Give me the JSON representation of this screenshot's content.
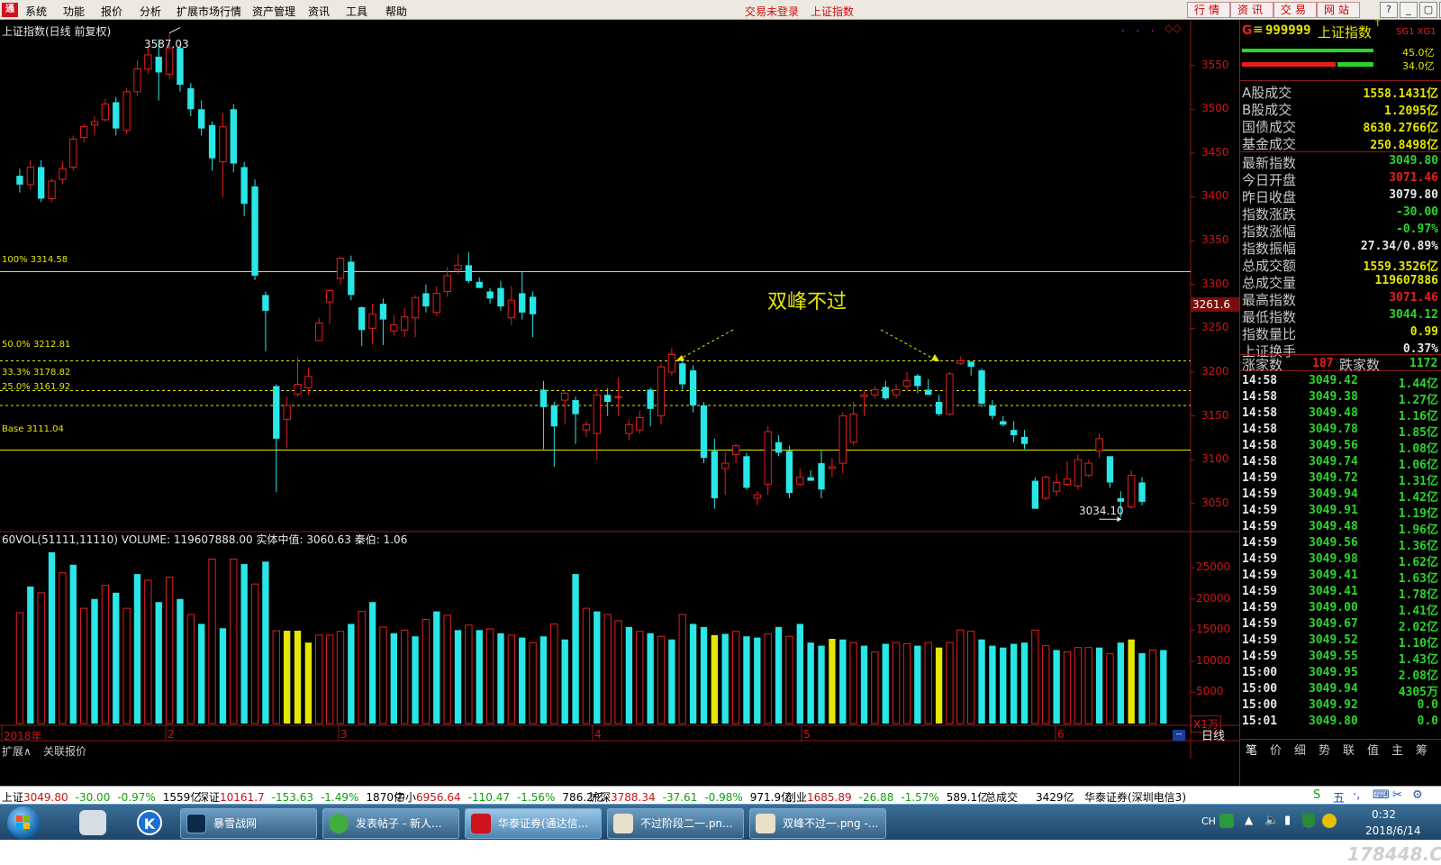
{
  "menu": {
    "logo": "通",
    "items": [
      "系统",
      "功能",
      "报价",
      "分析",
      "扩展市场行情",
      "资产管理",
      "资讯",
      "工具",
      "帮助"
    ],
    "status1": "交易未登录",
    "status2": "上证指数",
    "right_buttons": [
      "行情",
      "资讯",
      "交易",
      "网站"
    ],
    "window_buttons": [
      "?",
      "_",
      "▢",
      "✕"
    ]
  },
  "chart": {
    "title": "上证指数(日线 前复权)",
    "high_label": "3587.03",
    "low_label": "3034.10",
    "annotation": "双峰不过",
    "cursor_price": "3261.6",
    "fib": [
      {
        "label": "100% 3314.58",
        "value": 3314.58,
        "color": "#e6e600"
      },
      {
        "label": "50.0% 3212.81",
        "value": 3212.81,
        "color": "#e6e600"
      },
      {
        "label": "33.3% 3178.82",
        "value": 3178.82,
        "color": "#e6e600"
      },
      {
        "label": "25.0% 3161.92",
        "value": 3161.92,
        "color": "#e6e600"
      },
      {
        "label": "Base 3111.04",
        "value": 3111.04,
        "color": "#e6e600"
      }
    ],
    "price_axis": [
      "3550",
      "3500",
      "3450",
      "3400",
      "3350",
      "3300",
      "3250",
      "3200",
      "3150",
      "3100",
      "3050"
    ],
    "vol_title": "60VOL(51111,11110) VOLUME: 119607888.00 实体中值: 3060.63 秦伯: 1.06",
    "vol_axis": [
      "25000",
      "20000",
      "15000",
      "10000",
      "5000"
    ],
    "vol_unit": "X1万",
    "date_labels": [
      "2018年",
      "2",
      "3",
      "4",
      "5",
      "6"
    ],
    "bottom_tabs": [
      "扩展∧",
      "关联报价"
    ],
    "period": "日线"
  },
  "chart_data": {
    "type": "candlestick",
    "ylim": [
      3020,
      3600
    ],
    "candles": [
      [
        3424,
        3414,
        3432,
        3405
      ],
      [
        3414,
        3434,
        3442,
        3408
      ],
      [
        3434,
        3398,
        3442,
        3394
      ],
      [
        3398,
        3418,
        3421,
        3394
      ],
      [
        3420,
        3432,
        3440,
        3415
      ],
      [
        3434,
        3466,
        3470,
        3430
      ],
      [
        3468,
        3480,
        3484,
        3462
      ],
      [
        3482,
        3486,
        3492,
        3470
      ],
      [
        3488,
        3506,
        3512,
        3486
      ],
      [
        3508,
        3478,
        3514,
        3470
      ],
      [
        3476,
        3520,
        3524,
        3472
      ],
      [
        3520,
        3546,
        3556,
        3516
      ],
      [
        3546,
        3562,
        3572,
        3540
      ],
      [
        3560,
        3542,
        3580,
        3510
      ],
      [
        3540,
        3570,
        3587.03,
        3535
      ],
      [
        3570,
        3528,
        3574,
        3520
      ],
      [
        3524,
        3500,
        3530,
        3492
      ],
      [
        3500,
        3478,
        3510,
        3470
      ],
      [
        3482,
        3444,
        3486,
        3430
      ],
      [
        3440,
        3480,
        3496,
        3400
      ],
      [
        3500,
        3438,
        3506,
        3428
      ],
      [
        3434,
        3392,
        3440,
        3378
      ],
      [
        3412,
        3310,
        3420,
        3305
      ],
      [
        3288,
        3270,
        3292,
        3224
      ],
      [
        3184,
        3124,
        3186,
        3063
      ],
      [
        3146,
        3162,
        3172,
        3113
      ],
      [
        3175,
        3186,
        3217,
        3172
      ],
      [
        3182,
        3195,
        3205,
        3174
      ],
      [
        3236,
        3256,
        3262,
        3236
      ],
      [
        3280,
        3293,
        3294,
        3255
      ],
      [
        3307,
        3330,
        3332,
        3300
      ],
      [
        3326,
        3288,
        3333,
        3282
      ],
      [
        3274,
        3248,
        3275,
        3230
      ],
      [
        3250,
        3266,
        3278,
        3232
      ],
      [
        3278,
        3260,
        3284,
        3231
      ],
      [
        3247,
        3254,
        3265,
        3242
      ],
      [
        3248,
        3263,
        3273,
        3240
      ],
      [
        3262,
        3285,
        3288,
        3240
      ],
      [
        3290,
        3275,
        3300,
        3268
      ],
      [
        3268,
        3290,
        3298,
        3264
      ],
      [
        3292,
        3310,
        3320,
        3286
      ],
      [
        3317,
        3322,
        3335,
        3312
      ],
      [
        3322,
        3304,
        3337,
        3302
      ],
      [
        3303,
        3296,
        3308,
        3296
      ],
      [
        3292,
        3284,
        3296,
        3278
      ],
      [
        3296,
        3275,
        3304,
        3270
      ],
      [
        3262,
        3282,
        3298,
        3254
      ],
      [
        3290,
        3268,
        3315,
        3260
      ],
      [
        3286,
        3266,
        3292,
        3240
      ],
      [
        3180,
        3160,
        3190,
        3112
      ],
      [
        3162,
        3138,
        3166,
        3092
      ],
      [
        3168,
        3176,
        3178,
        3140
      ],
      [
        3168,
        3152,
        3172,
        3118
      ],
      [
        3134,
        3140,
        3144,
        3126
      ],
      [
        3130,
        3174,
        3182,
        3100
      ],
      [
        3174,
        3166,
        3182,
        3150
      ],
      [
        3172,
        3172,
        3194,
        3150
      ],
      [
        3130,
        3140,
        3146,
        3122
      ],
      [
        3134,
        3148,
        3156,
        3130
      ],
      [
        3180,
        3158,
        3182,
        3138
      ],
      [
        3150,
        3206,
        3210,
        3140
      ],
      [
        3200,
        3220,
        3228,
        3196
      ],
      [
        3210,
        3186,
        3214,
        3180
      ],
      [
        3202,
        3162,
        3208,
        3154
      ],
      [
        3162,
        3102,
        3166,
        3096
      ],
      [
        3110,
        3056,
        3124,
        3044
      ],
      [
        3090,
        3096,
        3108,
        3060
      ],
      [
        3106,
        3116,
        3118,
        3096
      ],
      [
        3104,
        3068,
        3108,
        3066
      ],
      [
        3056,
        3060,
        3064,
        3048
      ],
      [
        3072,
        3132,
        3138,
        3060
      ],
      [
        3120,
        3108,
        3128,
        3104
      ],
      [
        3110,
        3062,
        3116,
        3056
      ],
      [
        3072,
        3080,
        3090,
        3070
      ],
      [
        3080,
        3076,
        3088,
        3076
      ],
      [
        3096,
        3066,
        3110,
        3056
      ],
      [
        3090,
        3092,
        3102,
        3080
      ],
      [
        3096,
        3150,
        3154,
        3084
      ],
      [
        3120,
        3152,
        3166,
        3116
      ],
      [
        3172,
        3174,
        3178,
        3150
      ],
      [
        3174,
        3180,
        3184,
        3170
      ],
      [
        3183,
        3170,
        3190,
        3168
      ],
      [
        3174,
        3180,
        3186,
        3170
      ],
      [
        3184,
        3190,
        3200,
        3180
      ],
      [
        3196,
        3184,
        3198,
        3176
      ],
      [
        3180,
        3174,
        3192,
        3174
      ],
      [
        3166,
        3152,
        3174,
        3150
      ],
      [
        3152,
        3198,
        3200,
        3150
      ],
      [
        3210,
        3212.81,
        3218,
        3208
      ],
      [
        3212,
        3206,
        3212,
        3196
      ],
      [
        3202,
        3164,
        3204,
        3160
      ],
      [
        3162,
        3150,
        3168,
        3146
      ],
      [
        3144,
        3140,
        3150,
        3138
      ],
      [
        3134,
        3128,
        3144,
        3120
      ],
      [
        3126,
        3118,
        3134,
        3112
      ],
      [
        3076,
        3044,
        3080,
        3044
      ],
      [
        3056,
        3080,
        3082,
        3054
      ],
      [
        3064,
        3074,
        3084,
        3058
      ],
      [
        3072,
        3078,
        3098,
        3070
      ],
      [
        3070,
        3100,
        3106,
        3066
      ],
      [
        3082,
        3096,
        3100,
        3080
      ],
      [
        3110,
        3124,
        3130,
        3102
      ],
      [
        3104,
        3074,
        3104,
        3068
      ],
      [
        3056,
        3052,
        3064,
        3034.1
      ],
      [
        3046,
        3082,
        3088,
        3044
      ],
      [
        3074,
        3052,
        3080,
        3048
      ]
    ],
    "volume": [
      17800,
      22000,
      21000,
      27500,
      24200,
      25500,
      18500,
      20000,
      22200,
      21000,
      18500,
      24000,
      23000,
      19500,
      23500,
      20000,
      17500,
      16000,
      26400,
      15300,
      26400,
      25600,
      22400,
      26000,
      14900,
      14900,
      14900,
      13000,
      14200,
      14200,
      14800,
      16000,
      18000,
      19500,
      15500,
      14500,
      15000,
      14000,
      16700,
      18000,
      17400,
      15000,
      15800,
      15000,
      15200,
      14500,
      14200,
      13800,
      13000,
      14000,
      16000,
      13500,
      24000,
      18500,
      18000,
      17500,
      16500,
      15500,
      14800,
      14500,
      14000,
      13500,
      17500,
      16000,
      15500,
      14200,
      14400,
      14800,
      14000,
      13800,
      14400,
      15500,
      14000,
      16000,
      13000,
      12500,
      13600,
      13500,
      13000,
      12500,
      11500,
      12800,
      13000,
      12800,
      12500,
      13000,
      12200,
      13000,
      15000,
      14800,
      13500,
      12500,
      12200,
      12800,
      13000,
      15000,
      12500,
      11800,
      11500,
      12200,
      12200,
      12200,
      11200,
      13000,
      13500,
      11300,
      11800,
      11800
    ],
    "volume_color": [
      "r",
      "c",
      "r",
      "c",
      "r",
      "c",
      "r",
      "c",
      "r",
      "c",
      "r",
      "c",
      "r",
      "c",
      "r",
      "c",
      "r",
      "c",
      "r",
      "c",
      "r",
      "c",
      "r",
      "c",
      "r",
      "y",
      "y",
      "y",
      "r",
      "r",
      "r",
      "c",
      "r",
      "c",
      "r",
      "c",
      "r",
      "c",
      "r",
      "c",
      "r",
      "c",
      "r",
      "c",
      "r",
      "c",
      "r",
      "c",
      "r",
      "c",
      "r",
      "c",
      "c",
      "r",
      "c",
      "r",
      "r",
      "c",
      "r",
      "c",
      "r",
      "c",
      "r",
      "c",
      "c",
      "y",
      "c",
      "r",
      "c",
      "c",
      "r",
      "c",
      "r",
      "c",
      "c",
      "c",
      "y",
      "c",
      "r",
      "c",
      "r",
      "c",
      "r",
      "r",
      "c",
      "r",
      "y",
      "r",
      "r",
      "r",
      "c",
      "c",
      "c",
      "c",
      "c",
      "r",
      "r",
      "c",
      "r",
      "r",
      "r",
      "c",
      "r",
      "c",
      "y",
      "c",
      "r",
      "c"
    ],
    "series": [
      {
        "name": "VOLUME",
        "values": "see volume"
      }
    ]
  },
  "info": {
    "header_code": "999999",
    "header_name": "上证指数",
    "header_g": "G",
    "header_sub": "SG1 XG1",
    "bar_vals": [
      "45.0亿",
      "34.0亿"
    ],
    "rows": [
      {
        "k": "A股成交",
        "v": "1558.1431亿",
        "c": "#e6e600"
      },
      {
        "k": "B股成交",
        "v": "1.2095亿",
        "c": "#e6e600"
      },
      {
        "k": "国债成交",
        "v": "8630.2766亿",
        "c": "#e6e600"
      },
      {
        "k": "基金成交",
        "v": "250.8498亿",
        "c": "#e6e600"
      },
      {
        "k": "最新指数",
        "v": "3049.80",
        "c": "#2ad52a"
      },
      {
        "k": "今日开盘",
        "v": "3071.46",
        "c": "#e61e1e"
      },
      {
        "k": "昨日收盘",
        "v": "3079.80",
        "c": "#e8e8e8"
      },
      {
        "k": "指数涨跌",
        "v": "-30.00",
        "c": "#2ad52a"
      },
      {
        "k": "指数涨幅",
        "v": "-0.97%",
        "c": "#2ad52a"
      },
      {
        "k": "指数振幅",
        "v": "27.34/0.89%",
        "c": "#e8e8e8"
      },
      {
        "k": "总成交额",
        "v": "1559.3526亿",
        "c": "#e6e600"
      },
      {
        "k": "总成交量",
        "v": "119607886",
        "c": "#e6e600"
      },
      {
        "k": "最高指数",
        "v": "3071.46",
        "c": "#e61e1e"
      },
      {
        "k": "最低指数",
        "v": "3044.12",
        "c": "#2ad52a"
      },
      {
        "k": "指数量比",
        "v": "0.99",
        "c": "#e6e600"
      },
      {
        "k": "上证换手",
        "v": "0.37%",
        "c": "#e8e8e8"
      }
    ],
    "updown": {
      "up_label": "涨家数",
      "up": "187",
      "down_label": "跌家数",
      "down": "1172"
    },
    "ticks": [
      [
        "14:58",
        "3049.42",
        "1.44亿"
      ],
      [
        "14:58",
        "3049.38",
        "1.27亿"
      ],
      [
        "14:58",
        "3049.48",
        "1.16亿"
      ],
      [
        "14:58",
        "3049.78",
        "1.85亿"
      ],
      [
        "14:58",
        "3049.56",
        "1.08亿"
      ],
      [
        "14:58",
        "3049.74",
        "1.06亿"
      ],
      [
        "14:59",
        "3049.72",
        "1.31亿"
      ],
      [
        "14:59",
        "3049.94",
        "1.42亿"
      ],
      [
        "14:59",
        "3049.91",
        "1.19亿"
      ],
      [
        "14:59",
        "3049.48",
        "1.96亿"
      ],
      [
        "14:59",
        "3049.56",
        "1.36亿"
      ],
      [
        "14:59",
        "3049.98",
        "1.62亿"
      ],
      [
        "14:59",
        "3049.41",
        "1.63亿"
      ],
      [
        "14:59",
        "3049.41",
        "1.78亿"
      ],
      [
        "14:59",
        "3049.00",
        "1.41亿"
      ],
      [
        "14:59",
        "3049.67",
        "2.02亿"
      ],
      [
        "14:59",
        "3049.52",
        "1.10亿"
      ],
      [
        "14:59",
        "3049.55",
        "1.43亿"
      ],
      [
        "15:00",
        "3049.95",
        "2.08亿"
      ],
      [
        "15:00",
        "3049.94",
        "4305万"
      ],
      [
        "15:00",
        "3049.92",
        "0.0"
      ],
      [
        "15:01",
        "3049.80",
        "0.0"
      ]
    ],
    "tabs": [
      "笔",
      "价",
      "细",
      "势",
      "联",
      "值",
      "主",
      "筹"
    ]
  },
  "ticker": {
    "items": [
      {
        "name": "上证",
        "val": "3049.80",
        "chg": "-30.00",
        "pct": "-0.97%",
        "amt": "1559亿"
      },
      {
        "name": "深证",
        "val": "10161.7",
        "chg": "-153.63",
        "pct": "-1.49%",
        "amt": "1870亿"
      },
      {
        "name": "中小",
        "val": "6956.64",
        "chg": "-110.47",
        "pct": "-1.56%",
        "amt": "786.2亿"
      },
      {
        "name": "沪深",
        "val": "3788.34",
        "chg": "-37.61",
        "pct": "-0.98%",
        "amt": "971.9亿"
      },
      {
        "name": "创业",
        "val": "1685.89",
        "chg": "-26.88",
        "pct": "-1.57%",
        "amt": "589.1亿"
      }
    ],
    "total_label": "总成交",
    "total": "3429亿",
    "broker": "华泰证券(深圳电信3)",
    "tray": [
      "S",
      "五",
      "·,",
      "⌨",
      "✂",
      "⚙"
    ]
  },
  "taskbar": {
    "tasks": [
      "暴雪战网",
      "发表帖子 - 新人...",
      "华泰证券(通达信...",
      "不过阶段二一.pn...",
      "双峰不过一.png -..."
    ],
    "lang": "CH",
    "time": "0:32",
    "date": "2018/6/14",
    "watermark": "178448.COM"
  }
}
